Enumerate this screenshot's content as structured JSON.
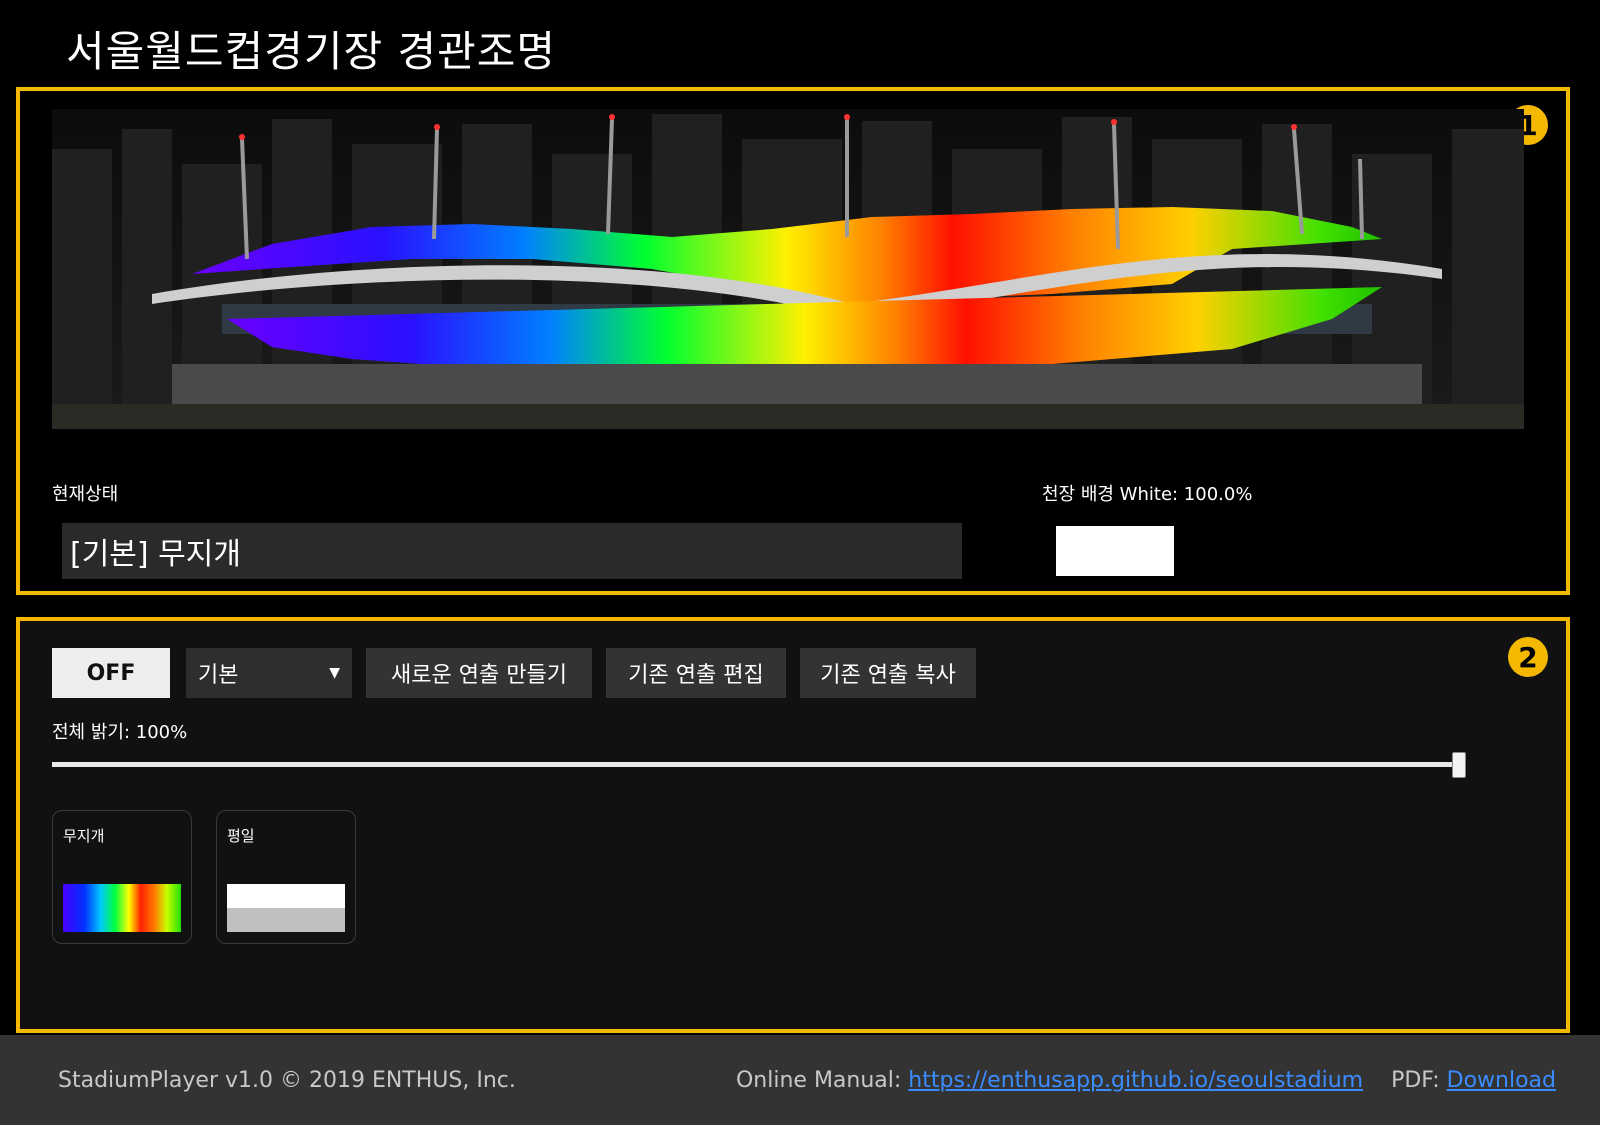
{
  "header": {
    "title": "서울월드컵경기장 경관조명"
  },
  "panel1": {
    "badge": "1",
    "status_label": "현재상태",
    "status_value": "[기본] 무지개",
    "ceiling_label": "천장 배경 White: 100.0%",
    "ceiling_color": "#ffffff"
  },
  "panel2": {
    "badge": "2",
    "toolbar": {
      "off_label": "OFF",
      "select_value": "기본",
      "new_label": "새로운 연출 만들기",
      "edit_label": "기존 연출 편집",
      "copy_label": "기존 연출 복사"
    },
    "brightness": {
      "label": "전체 밝기: 100%",
      "value": 100
    },
    "presets": [
      {
        "name": "무지개",
        "preview": "rainbow"
      },
      {
        "name": "평일",
        "preview": "white-gray"
      }
    ]
  },
  "footer": {
    "copyright": "StadiumPlayer v1.0 © 2019 ENTHUS, Inc.",
    "manual_label": "Online Manual:",
    "manual_link": "https://enthusapp.github.io/seoulstadium",
    "pdf_label": "PDF:",
    "pdf_link": "Download"
  }
}
